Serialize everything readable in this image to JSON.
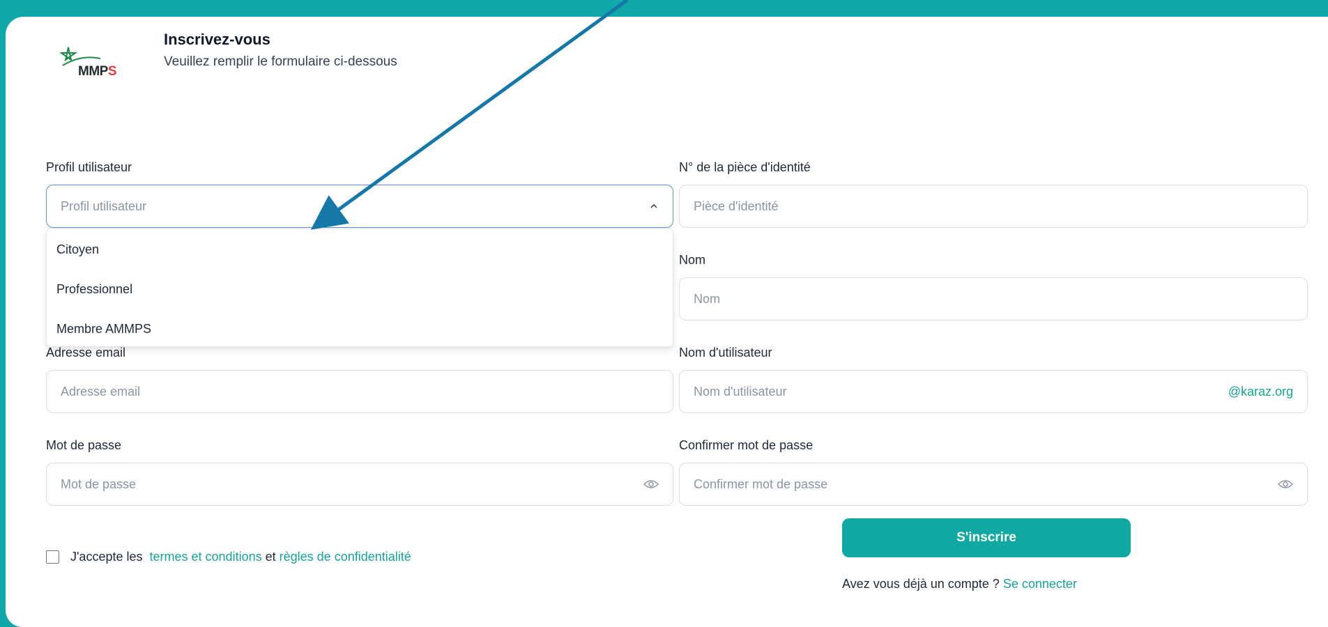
{
  "header": {
    "logo_text_main": "MMP",
    "logo_text_s": "S",
    "title": "Inscrivez-vous",
    "subtitle": "Veuillez remplir le formulaire ci-dessous"
  },
  "fields": {
    "profil": {
      "label": "Profil utilisateur",
      "placeholder": "Profil utilisateur"
    },
    "piece": {
      "label": "N° de la pièce d'identité",
      "placeholder": "Pièce d'identité"
    },
    "nom": {
      "label": "Nom",
      "placeholder": "Nom"
    },
    "email": {
      "label": "Adresse email",
      "placeholder": "Adresse email"
    },
    "username": {
      "label": "Nom d'utilisateur",
      "placeholder": "Nom d'utilisateur",
      "suffix": "@karaz.org"
    },
    "password": {
      "label": "Mot de passe",
      "placeholder": "Mot de passe"
    },
    "confirm": {
      "label": "Confirmer mot de passe",
      "placeholder": "Confirmer mot de passe"
    }
  },
  "dropdown": {
    "options": [
      "Citoyen",
      "Professionnel",
      "Membre AMMPS"
    ]
  },
  "terms": {
    "prefix": "J'accepte les",
    "terms_link": "termes et conditions",
    "middle": "et",
    "privacy_link": "règles de confidentialité"
  },
  "actions": {
    "submit_label": "S'inscrire",
    "login_prompt": "Avez vous déjà un compte ?",
    "login_link": "Se connecter"
  },
  "colors": {
    "accent": "#10a8a2",
    "background": "#10a8a8",
    "annotation_arrow": "#1578a8"
  }
}
